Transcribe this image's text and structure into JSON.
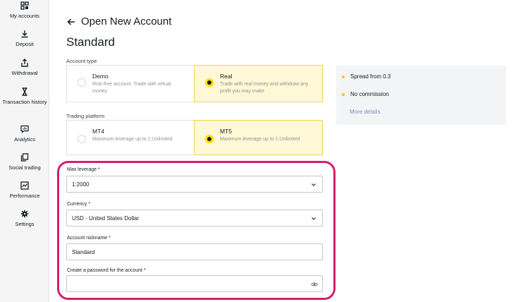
{
  "sidebar": {
    "items": [
      {
        "label": "My accounts",
        "icon": "grid-icon"
      },
      {
        "label": "Deposit",
        "icon": "download-icon"
      },
      {
        "label": "Withdrawal",
        "icon": "upload-icon"
      },
      {
        "label": "Transaction history",
        "icon": "hourglass-icon"
      },
      {
        "label": "Analytics",
        "icon": "chat-chart-icon"
      },
      {
        "label": "Social trading",
        "icon": "copy-icon"
      },
      {
        "label": "Performance",
        "icon": "performance-chart-icon"
      },
      {
        "label": "Settings",
        "icon": "gear-icon"
      }
    ]
  },
  "header": {
    "title": "Open New Account",
    "plan": "Standard"
  },
  "account_type": {
    "label": "Account type",
    "options": [
      {
        "title": "Demo",
        "desc": "Risk-free account. Trade with virtual money",
        "selected": false
      },
      {
        "title": "Real",
        "desc": "Trade with real money and withdraw any profit you may make",
        "selected": true
      }
    ]
  },
  "trading_platform": {
    "label": "Trading platform",
    "options": [
      {
        "title": "MT4",
        "desc": "Maximum leverage up to 1:Unlimited",
        "selected": false
      },
      {
        "title": "MT5",
        "desc": "Maximum leverage up to 1:Unlimited",
        "selected": true
      }
    ]
  },
  "info": {
    "items": [
      "Spread from 0.3",
      "No commission"
    ],
    "link": "More details"
  },
  "form": {
    "leverage": {
      "label": "Max leverage *",
      "value": "1:2000"
    },
    "currency": {
      "label": "Currency *",
      "value": "USD - United States Dollar"
    },
    "nickname": {
      "label": "Account nickname *",
      "value": "Standard"
    },
    "password": {
      "label": "Create a password for the account *",
      "value": ""
    }
  },
  "colors": {
    "accent": "#ffde02",
    "selected_bg": "#fff8d6",
    "highlight": "#d61f69",
    "link": "#7a8fc2"
  }
}
